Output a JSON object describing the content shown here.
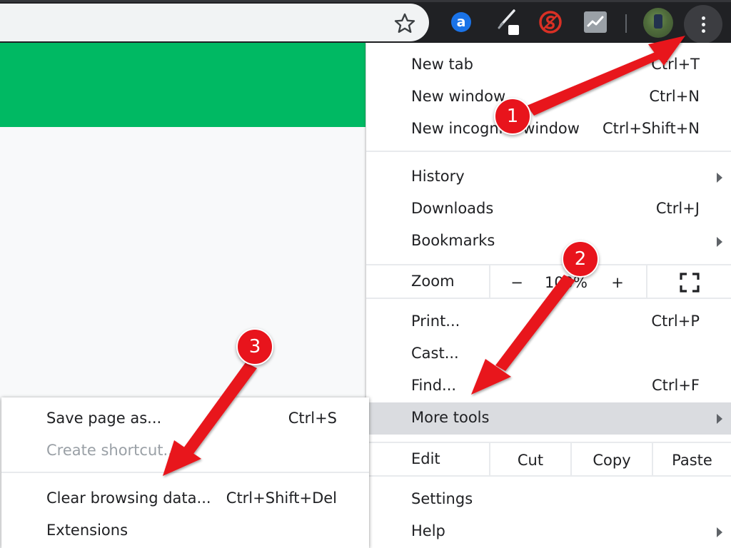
{
  "toolbar": {
    "icons": [
      "star-icon",
      "a-extension-icon",
      "pen-extension-icon",
      "s-extension-icon",
      "chart-extension-icon",
      "avatar",
      "kebab-menu-icon"
    ],
    "extension_a_letter": "a"
  },
  "menu": {
    "items": [
      {
        "label": "New tab",
        "shortcut": "Ctrl+T"
      },
      {
        "label": "New window",
        "shortcut": "Ctrl+N"
      },
      {
        "label": "New incognito window",
        "shortcut": "Ctrl+Shift+N"
      },
      {
        "label": "History",
        "shortcut": ""
      },
      {
        "label": "Downloads",
        "shortcut": "Ctrl+J"
      },
      {
        "label": "Bookmarks",
        "shortcut": ""
      },
      {
        "label": "Print...",
        "shortcut": "Ctrl+P"
      },
      {
        "label": "Cast...",
        "shortcut": ""
      },
      {
        "label": "Find...",
        "shortcut": "Ctrl+F"
      },
      {
        "label": "More tools",
        "shortcut": ""
      },
      {
        "label": "Settings",
        "shortcut": ""
      },
      {
        "label": "Help",
        "shortcut": ""
      }
    ],
    "zoom": {
      "label": "Zoom",
      "minus": "−",
      "value": "100%",
      "plus": "+"
    },
    "edit": {
      "label": "Edit",
      "cut": "Cut",
      "copy": "Copy",
      "paste": "Paste"
    }
  },
  "submenu": {
    "items": [
      {
        "label": "Save page as...",
        "shortcut": "Ctrl+S"
      },
      {
        "label": "Create shortcut...",
        "shortcut": ""
      },
      {
        "label": "Clear browsing data...",
        "shortcut": "Ctrl+Shift+Del"
      },
      {
        "label": "Extensions",
        "shortcut": ""
      }
    ]
  },
  "annotations": {
    "badges": [
      "1",
      "2",
      "3"
    ],
    "color": "#e8141c"
  },
  "colors": {
    "toolbar": "#202124",
    "banner": "#00b963",
    "menu_active": "#dadce0",
    "badge": "#e8141c"
  }
}
